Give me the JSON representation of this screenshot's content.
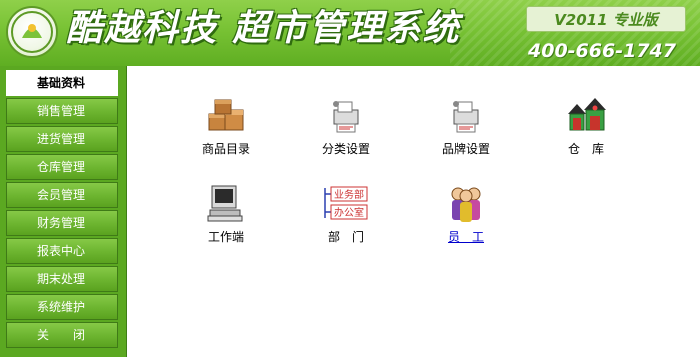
{
  "header": {
    "title": "酷越科技 超市管理系统",
    "version": "V2011 专业版",
    "hotline": "400-666-1747",
    "colors": {
      "header_green": "#78c234",
      "sidebar_green": "#5ba821",
      "link_blue": "#0000cc"
    }
  },
  "sidebar": {
    "items": [
      {
        "label": "基础资料",
        "active": true
      },
      {
        "label": "销售管理",
        "active": false
      },
      {
        "label": "进货管理",
        "active": false
      },
      {
        "label": "仓库管理",
        "active": false
      },
      {
        "label": "会员管理",
        "active": false
      },
      {
        "label": "财务管理",
        "active": false
      },
      {
        "label": "报表中心",
        "active": false
      },
      {
        "label": "期末处理",
        "active": false
      },
      {
        "label": "系统维护",
        "active": false
      },
      {
        "label": "关　　闭",
        "active": false
      }
    ]
  },
  "main": {
    "tiles": [
      {
        "label": "商品目录",
        "icon": "boxes-icon"
      },
      {
        "label": "分类设置",
        "icon": "category-printer-icon"
      },
      {
        "label": "品牌设置",
        "icon": "brand-printer-icon"
      },
      {
        "label": "仓　库",
        "icon": "warehouse-icon"
      },
      {
        "label": "工作端",
        "icon": "computer-terminal-icon"
      },
      {
        "label": "部　门",
        "icon": "department-tree-icon",
        "icon_text": [
          "业务部",
          "办公室"
        ]
      },
      {
        "label": "员　工",
        "icon": "people-icon",
        "link": true
      }
    ]
  }
}
